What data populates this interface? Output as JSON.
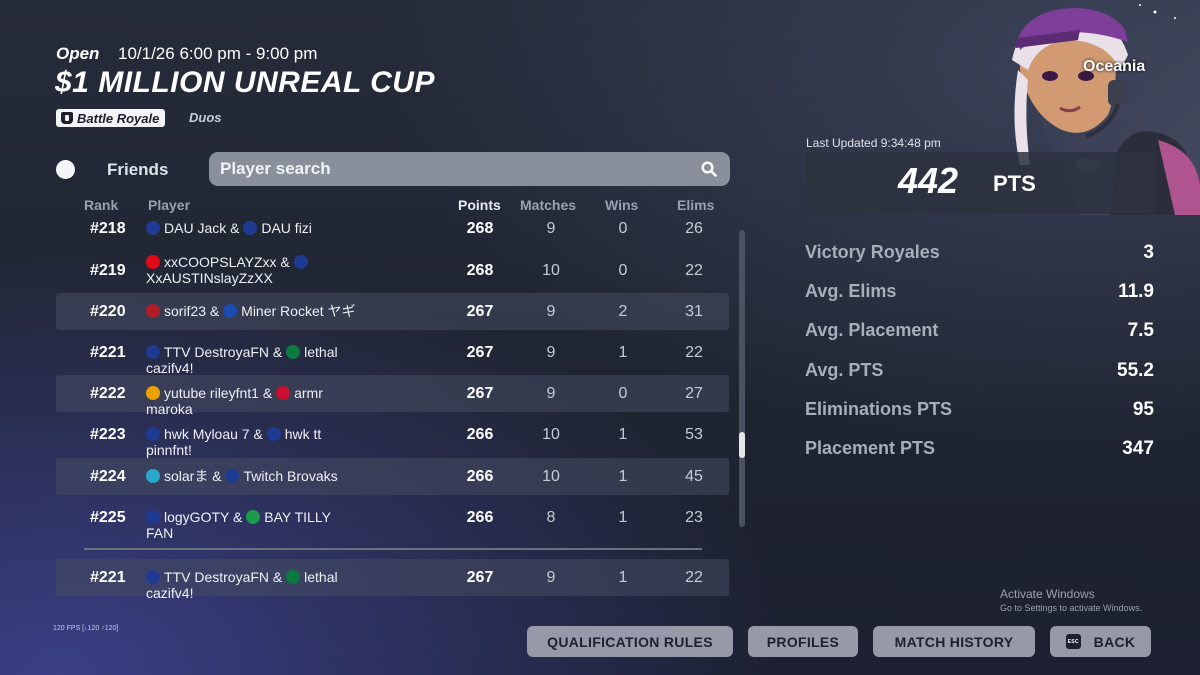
{
  "event": {
    "status": "Open",
    "time": "10/1/26 6:00 pm - 9:00 pm",
    "title": "$1 MILLION UNREAL CUP",
    "mode": "Battle Royale",
    "team_size": "Duos"
  },
  "friends_label": "Friends",
  "search": {
    "placeholder": "Player search",
    "value": ""
  },
  "columns": [
    "Rank",
    "Player",
    "Points",
    "Matches",
    "Wins",
    "Elims"
  ],
  "rows": [
    {
      "rank": "#218",
      "p1_flag": "AU",
      "p1": "DAU Jack",
      "p2_flag": "AU",
      "p2": "DAU fizi",
      "points": "268",
      "matches": "9",
      "wins": "0",
      "elims": "26"
    },
    {
      "rank": "#219",
      "p1_flag": "TR",
      "p1": "xxCOOPSLAYZxx",
      "p2_flag": "AU",
      "p2": "XxAUSTINslayZzXX",
      "points": "268",
      "matches": "10",
      "wins": "0",
      "elims": "22"
    },
    {
      "rank": "#220",
      "p1_flag": "NL",
      "p1": "sorif23",
      "p2_flag": "FR",
      "p2": "Miner Rocket ヤギ",
      "points": "267",
      "matches": "9",
      "wins": "2",
      "elims": "31"
    },
    {
      "rank": "#221",
      "p1_flag": "AU",
      "p1": "TTV DestroyaFN",
      "p2_flag": "MX",
      "p2": "lethal cazifv4!",
      "points": "267",
      "matches": "9",
      "wins": "1",
      "elims": "22"
    },
    {
      "rank": "#222",
      "p1_flag": "ES",
      "p1": "yutube rileyfnt1",
      "p2_flag": "DK",
      "p2": "armr maroka",
      "points": "267",
      "matches": "9",
      "wins": "0",
      "elims": "27"
    },
    {
      "rank": "#223",
      "p1_flag": "AU",
      "p1": "hwk Myloau 7",
      "p2_flag": "AU",
      "p2": "hwk tt pinnfnt!",
      "points": "266",
      "matches": "10",
      "wins": "1",
      "elims": "53"
    },
    {
      "rank": "#224",
      "p1_flag": "GLOBE",
      "p1": "solarま",
      "p2_flag": "AU",
      "p2": "Twitch Brovaks",
      "points": "266",
      "matches": "10",
      "wins": "1",
      "elims": "45"
    },
    {
      "rank": "#225",
      "p1_flag": "AU",
      "p1": "logyGOTY",
      "p2_flag": "IT",
      "p2": "BAY TILLY FAN",
      "points": "266",
      "matches": "8",
      "wins": "1",
      "elims": "23"
    }
  ],
  "my_row": {
    "rank": "#221",
    "p1_flag": "AU",
    "p1": "TTV DestroyaFN",
    "p2_flag": "MX",
    "p2": "lethal cazifv4!",
    "points": "267",
    "matches": "9",
    "wins": "1",
    "elims": "22"
  },
  "panel": {
    "region": "Oceania",
    "last_updated": "Last Updated 9:34:48 pm",
    "points": "442",
    "points_unit": "PTS",
    "stats": [
      {
        "label": "Victory Royales",
        "value": "3"
      },
      {
        "label": "Avg. Elims",
        "value": "11.9"
      },
      {
        "label": "Avg. Placement",
        "value": "7.5"
      },
      {
        "label": "Avg. PTS",
        "value": "55.2"
      },
      {
        "label": "Eliminations PTS",
        "value": "95"
      },
      {
        "label": "Placement PTS",
        "value": "347"
      }
    ]
  },
  "watermark": {
    "title": "Activate Windows",
    "subtitle": "Go to Settings to activate Windows."
  },
  "fps": "120 FPS [↓120 ↑120]",
  "buttons": {
    "qualification_rules": "QUALIFICATION RULES",
    "profiles": "PROFILES",
    "match_history": "MATCH HISTORY",
    "back": "BACK",
    "back_key": "ESC"
  },
  "flag_colors": {
    "AU": "#1f3a93",
    "TR": "#e30a17",
    "NL": "#ae1c28",
    "FR": "#1d4bb0",
    "MX": "#0b7a3e",
    "ES": "#e9a100",
    "DK": "#c8102e",
    "IT": "#1a9a4a",
    "GLOBE": "#2aa7c9"
  }
}
